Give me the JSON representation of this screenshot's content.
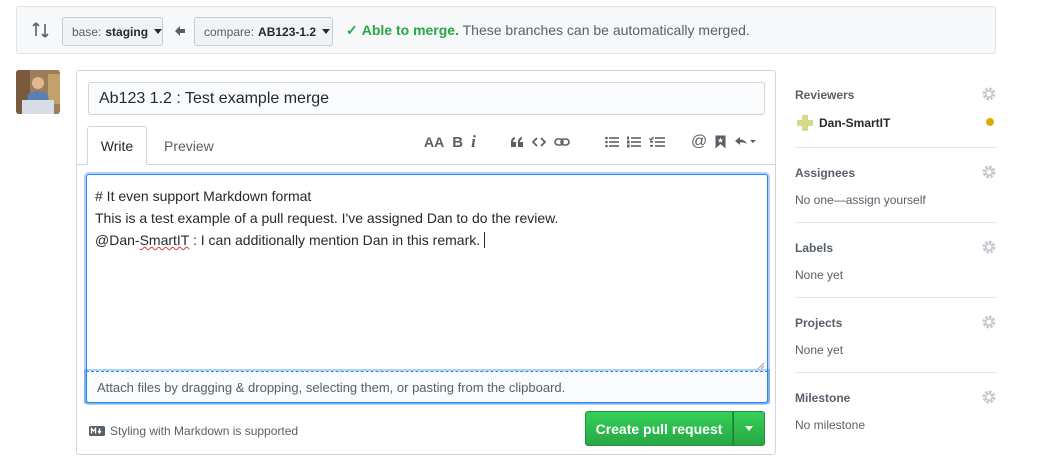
{
  "compare": {
    "base_prefix": "base:",
    "base_branch": "staging",
    "compare_prefix": "compare:",
    "compare_branch": "AB123-1.2",
    "status_ok": "Able to merge.",
    "status_text": "These branches can be automatically merged."
  },
  "form": {
    "title_value": "Ab123 1.2 : Test example merge",
    "tabs": [
      {
        "label": "Write",
        "active": true
      },
      {
        "label": "Preview",
        "active": false
      }
    ],
    "toolbar_icons": [
      "header-icon",
      "bold-icon",
      "italic-icon",
      "quote-icon",
      "code-icon",
      "link-icon",
      "bullet-list-icon",
      "numbered-list-icon",
      "task-list-icon",
      "mention-icon",
      "bookmark-icon",
      "reply-icon"
    ],
    "toolbar_text": {
      "header": "AA",
      "bold": "B",
      "italic": "i",
      "mention": "@"
    },
    "body_lines": [
      "# It even support Markdown format",
      "This is a test example of a pull request. I've assigned Dan to do the review."
    ],
    "body_mention_prefix": "@Dan-",
    "body_mention_word": "SmartIT",
    "body_mention_rest": " : I can additionally mention Dan in this remark.",
    "attach_text": "Attach files by dragging & dropping, selecting them, or pasting from the clipboard.",
    "markdown_note": "Styling with Markdown is supported",
    "create_label": "Create pull request"
  },
  "sidebar": {
    "reviewers": {
      "heading": "Reviewers",
      "name": "Dan-SmartIT",
      "status_color": "#dbab09"
    },
    "assignees": {
      "heading": "Assignees",
      "value": "No one—assign yourself"
    },
    "labels": {
      "heading": "Labels",
      "value": "None yet"
    },
    "projects": {
      "heading": "Projects",
      "value": "None yet"
    },
    "milestone": {
      "heading": "Milestone",
      "value": "No milestone"
    }
  },
  "colors": {
    "accent_green": "#28a745",
    "focus_blue": "#2188ff",
    "pending": "#dbab09"
  }
}
